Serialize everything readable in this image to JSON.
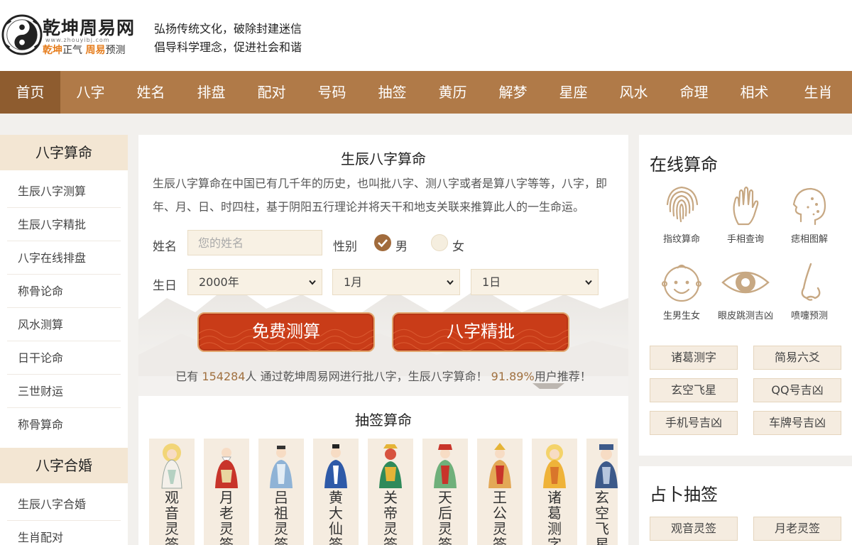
{
  "brand": {
    "title": "乾坤周易网",
    "domain": "www.zhouyibj.com",
    "slogan_a": "乾坤",
    "slogan_b": "正气",
    "slogan_c": "周易",
    "slogan_d": "预测",
    "accent_color": "#e67e1e"
  },
  "tagline": {
    "line1": "弘扬传统文化，破除封建迷信",
    "line2": "倡导科学理念，促进社会和谐"
  },
  "nav": {
    "color": "#b07a48",
    "active_color": "#8e5c2f",
    "items": [
      "首页",
      "八字",
      "姓名",
      "排盘",
      "配对",
      "号码",
      "抽签",
      "黄历",
      "解梦",
      "星座",
      "风水",
      "命理",
      "相术",
      "生肖"
    ]
  },
  "left": {
    "bazi_title": "八字算命",
    "bazi_items": [
      "生辰八字测算",
      "生辰八字精批",
      "八字在线排盘",
      "称骨论命",
      "风水测算",
      "日干论命",
      "三世财运",
      "称骨算命"
    ],
    "marriage_title": "八字合婚",
    "marriage_items": [
      "生辰八字合婚",
      "生肖配对"
    ]
  },
  "bazi": {
    "title": "生辰八字算命",
    "desc": "生辰八字算命在中国已有几千年的历史，也叫批八字、测八字或者是算八字等等，八字，即年、月、日、时四柱，基于阴阳五行理论并将天干和地支关联来推算此人的一生命运。",
    "name_label": "姓名",
    "name_placeholder": "您的姓名",
    "gender_label": "性别",
    "male": "男",
    "female": "女",
    "birth_label": "生日",
    "year": "2000年",
    "month": "1月",
    "day": "1日",
    "btn_free": "免费测算",
    "btn_detail": "八字精批",
    "stats_a": "已有",
    "stats_count": "154284",
    "stats_b": "人 通过乾坤周易网进行批八字，生辰八字算命！",
    "stats_pct": "91.89%",
    "stats_c": "用户推荐！"
  },
  "lots": {
    "title": "抽签算命",
    "deities": [
      "观音灵签",
      "月老灵签",
      "吕祖灵签",
      "黄大仙签",
      "关帝灵签",
      "天后灵签",
      "王公灵签",
      "诸葛测字",
      "玄空飞星"
    ]
  },
  "online": {
    "title": "在线算命",
    "tools": [
      {
        "label": "指纹算命",
        "icon": "fingerprint-icon"
      },
      {
        "label": "手相查询",
        "icon": "palm-icon"
      },
      {
        "label": "痣相图解",
        "icon": "face-mole-icon"
      },
      {
        "label": "生男生女",
        "icon": "baby-face-icon"
      },
      {
        "label": "眼皮跳测吉凶",
        "icon": "eye-icon"
      },
      {
        "label": "喷嚏预测",
        "icon": "nose-icon"
      }
    ],
    "buttons": [
      "诸葛测字",
      "简易六爻",
      "玄空飞星",
      "QQ号吉凶",
      "手机号吉凶",
      "车牌号吉凶"
    ]
  },
  "divination": {
    "title": "占卜抽签",
    "buttons": [
      "观音灵签",
      "月老灵签"
    ]
  }
}
